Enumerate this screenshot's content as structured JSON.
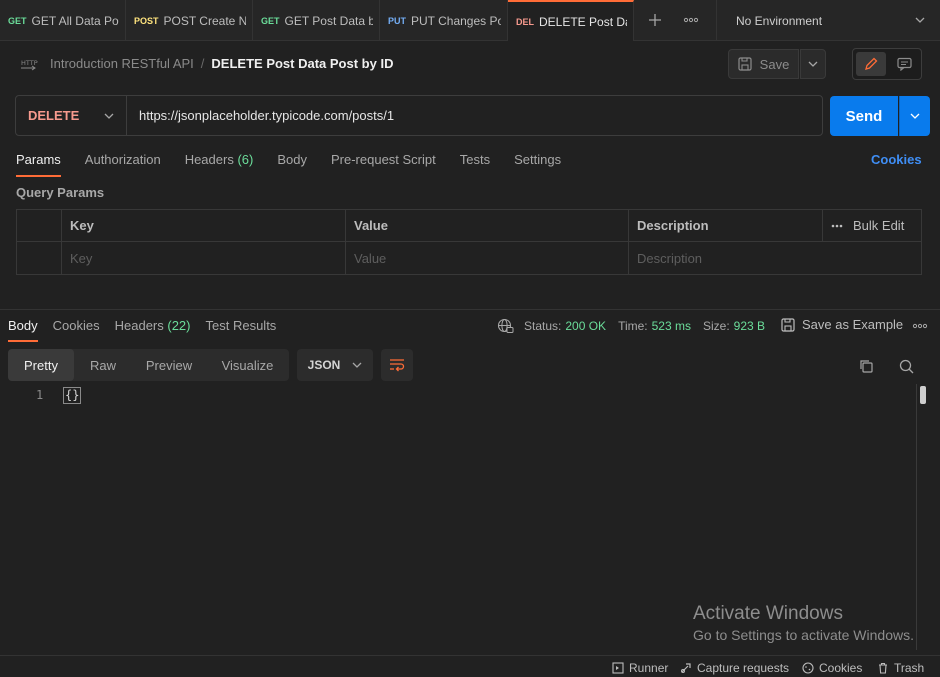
{
  "tabs": [
    {
      "method": "GET",
      "method_color": "#6bdd9a",
      "title": "GET All Data Pos"
    },
    {
      "method": "POST",
      "method_color": "#ffe47e",
      "title": "POST Create N"
    },
    {
      "method": "GET",
      "method_color": "#6bdd9a",
      "title": "GET Post Data b"
    },
    {
      "method": "PUT",
      "method_color": "#74aef6",
      "title": "PUT Changes Po"
    },
    {
      "method": "DEL",
      "method_color": "#f79a8e",
      "title": "DELETE Post Dat"
    }
  ],
  "environment": {
    "label": "No Environment"
  },
  "breadcrumb": {
    "icon_label": "HTTP",
    "collection": "Introduction RESTful API",
    "separator": "/",
    "request": "DELETE Post Data Post by ID"
  },
  "toolbar": {
    "save_label": "Save"
  },
  "request": {
    "method": "DELETE",
    "url": "https://jsonplaceholder.typicode.com/posts/1",
    "send_label": "Send"
  },
  "request_tabs": {
    "params": "Params",
    "authorization": "Authorization",
    "headers": "Headers",
    "headers_count": "(6)",
    "body": "Body",
    "pre_request": "Pre-request Script",
    "tests": "Tests",
    "settings": "Settings",
    "cookies": "Cookies"
  },
  "query_params": {
    "title": "Query Params",
    "columns": {
      "key": "Key",
      "value": "Value",
      "description": "Description"
    },
    "bulk_edit": "Bulk Edit",
    "placeholders": {
      "key": "Key",
      "value": "Value",
      "description": "Description"
    }
  },
  "response": {
    "tabs": {
      "body": "Body",
      "cookies": "Cookies",
      "headers": "Headers",
      "headers_count": "(22)",
      "test_results": "Test Results"
    },
    "status_label": "Status:",
    "status_value": "200 OK",
    "time_label": "Time:",
    "time_value": "523 ms",
    "size_label": "Size:",
    "size_value": "923 B",
    "save_example": "Save as Example",
    "view_modes": [
      "Pretty",
      "Raw",
      "Preview",
      "Visualize"
    ],
    "format": "JSON",
    "line_number": "1",
    "body_text": "{}"
  },
  "watermark": {
    "line1": "Activate Windows",
    "line2": "Go to Settings to activate Windows."
  },
  "footer": {
    "runner": "Runner",
    "capture": "Capture requests",
    "cookies": "Cookies",
    "trash": "Trash"
  },
  "colors": {
    "accent": "#ff6c37",
    "send": "#097bed",
    "success": "#6bdd9a",
    "link": "#3f8ef5"
  }
}
